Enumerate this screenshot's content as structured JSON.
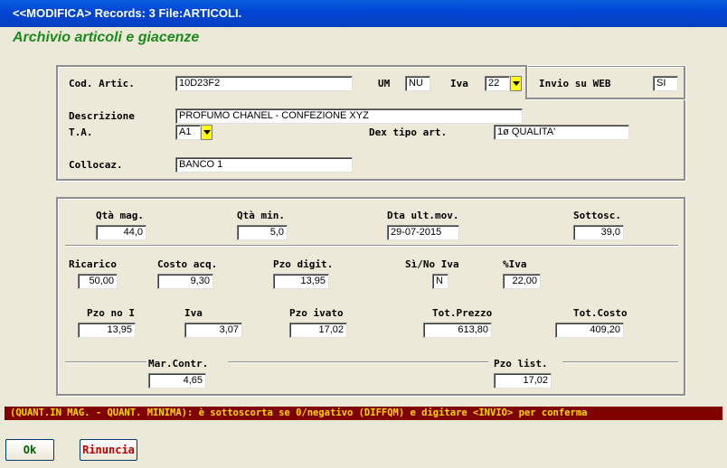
{
  "window": {
    "title": "<<MODIFICA> Records: 3  File:ARTICOLI."
  },
  "heading": "Archivio articoli e giacenze",
  "article": {
    "cod_label": "Cod. Artic.",
    "cod_value": "10D23F2",
    "um_label": "UM",
    "um_value": "NU",
    "iva_label": "Iva",
    "iva_value": "22",
    "web_label": "Invio su WEB",
    "web_value": "SI",
    "desc_label": "Descrizione",
    "desc_value": "PROFUMO CHANEL - CONFEZIONE XYZ",
    "ta_label": "T.A.",
    "ta_value": "A1",
    "dex_label": "Dex tipo art.",
    "dex_value": "1ø QUALITA'",
    "colloc_label": "Collocaz.",
    "colloc_value": "BANCO 1"
  },
  "stock": {
    "qta_mag_label": "Qtà mag.",
    "qta_mag_value": "44,0",
    "qta_min_label": "Qtà min.",
    "qta_min_value": "5,0",
    "dta_label": "Dta ult.mov.",
    "dta_value": "29-07-2015",
    "sottosc_label": "Sottosc.",
    "sottosc_value": "39,0"
  },
  "pricing": {
    "ricarico_label": "Ricarico",
    "ricarico_value": "50,00",
    "costo_label": "Costo acq.",
    "costo_value": "9,30",
    "pzo_digit_label": "Pzo digit.",
    "pzo_digit_value": "13,95",
    "sino_label": "Sì/No Iva",
    "sino_value": "N",
    "piva_label": "%Iva",
    "piva_value": "22,00",
    "pzo_noi_label": "Pzo no I",
    "pzo_noi_value": "13,95",
    "iva_label": "Iva",
    "iva_value": "3,07",
    "pzo_ivato_label": "Pzo ivato",
    "pzo_ivato_value": "17,02",
    "tot_prezzo_label": "Tot.Prezzo",
    "tot_prezzo_value": "613,80",
    "tot_costo_label": "Tot.Costo",
    "tot_costo_value": "409,20",
    "mar_label": "Mar.Contr.",
    "mar_value": "4,65",
    "pzo_list_label": "Pzo list.",
    "pzo_list_value": "17,02"
  },
  "status": "(QUANT.IN MAG. - QUANT. MINIMA): è sottoscorta se 0/negativo    (DIFFQM)    e digitare <INVIO> per conferma",
  "buttons": {
    "ok": "Ok",
    "rinuncia": "Rinuncia"
  },
  "colors": {
    "title_bar": "#0046d5",
    "heading": "#1c8a1c",
    "status_bg": "#800000",
    "status_fg": "#ffd700",
    "combo_button": "#ffff00",
    "rinuncia_text": "#c00000",
    "ok_text": "#006000"
  }
}
